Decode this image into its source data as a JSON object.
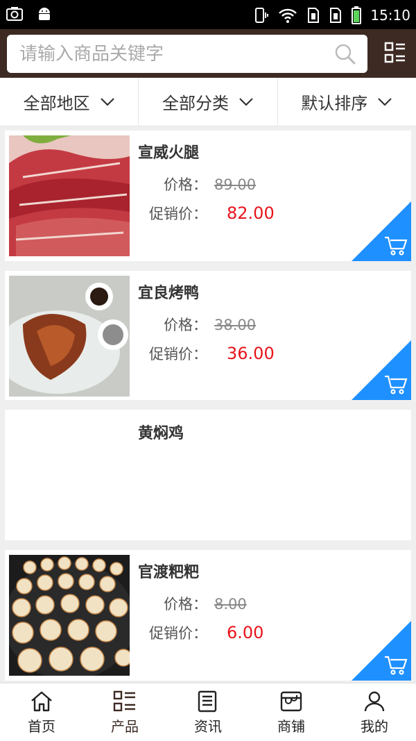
{
  "status_bar": {
    "time": "15:10"
  },
  "search": {
    "placeholder": "请输入商品关键字"
  },
  "filters": [
    {
      "label": "全部地区"
    },
    {
      "label": "全部分类"
    },
    {
      "label": "默认排序"
    }
  ],
  "labels": {
    "price": "价格：",
    "promo": "促销价："
  },
  "products": [
    {
      "name": "宣威火腿",
      "price": "89.00",
      "promo_price": "82.00",
      "image": "ham-photo"
    },
    {
      "name": "宜良烤鸭",
      "price": "38.00",
      "promo_price": "36.00",
      "image": "roast-duck-photo"
    },
    {
      "name": "黄焖鸡",
      "price": "",
      "promo_price": "",
      "image": ""
    },
    {
      "name": "官渡粑粑",
      "price": "8.00",
      "promo_price": "6.00",
      "image": "baba-cakes-photo"
    }
  ],
  "tabs": [
    {
      "label": "首页",
      "icon": "home-icon"
    },
    {
      "label": "产品",
      "icon": "list-icon"
    },
    {
      "label": "资讯",
      "icon": "news-icon"
    },
    {
      "label": "商铺",
      "icon": "shop-icon"
    },
    {
      "label": "我的",
      "icon": "user-icon"
    }
  ],
  "colors": {
    "header": "#3d2a23",
    "accent_blue": "#1e90ff",
    "price_red": "#e8131a"
  }
}
